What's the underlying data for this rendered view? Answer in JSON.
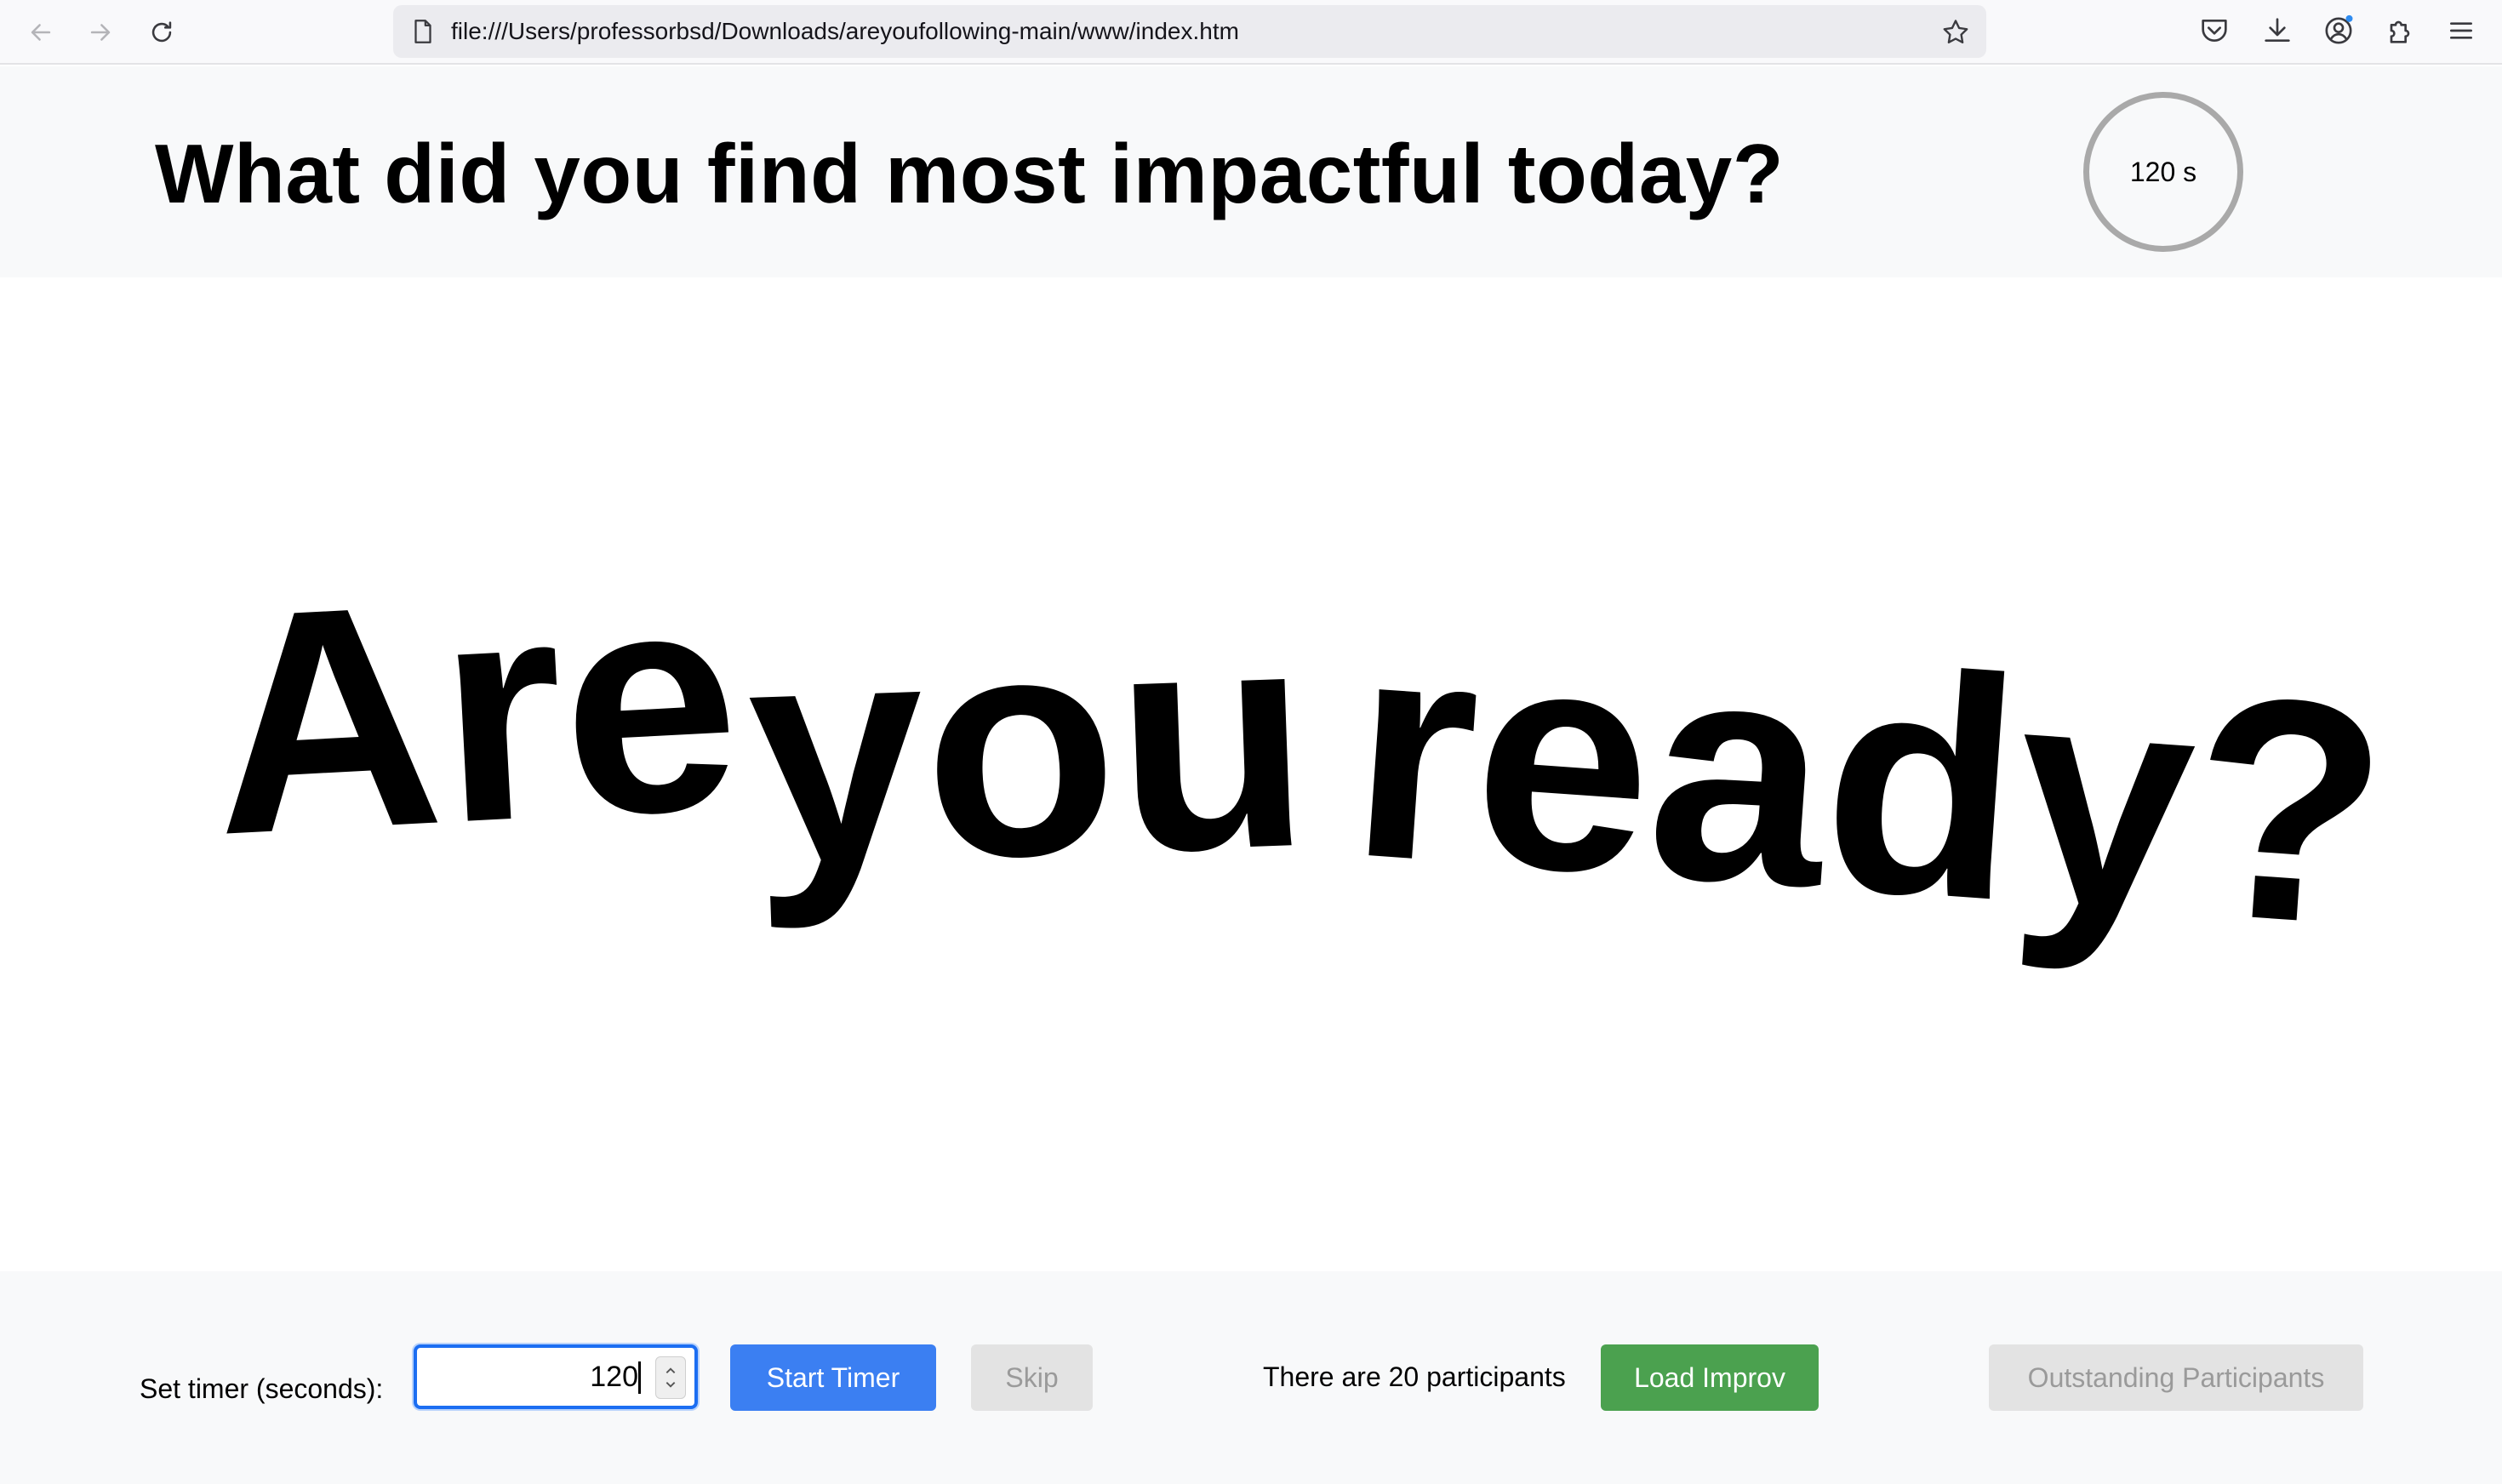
{
  "browser": {
    "url": "file:///Users/professorbsd/Downloads/areyoufollowing-main/www/index.htm",
    "toolbar_icons": [
      "back-arrow-icon",
      "forward-arrow-icon",
      "reload-icon",
      "page-icon",
      "bookmark-star-icon",
      "pocket-icon",
      "download-icon",
      "account-icon",
      "extensions-icon",
      "menu-icon"
    ]
  },
  "header": {
    "question": "What did you find most impactful today?",
    "timer_display": "120 s"
  },
  "stage": {
    "words": [
      "Are",
      "you",
      "ready?"
    ]
  },
  "controls": {
    "timer_label": "Set timer (seconds):",
    "timer_value": "120",
    "start_label": "Start Timer",
    "skip_label": "Skip",
    "participants_text": "There are 20 participants",
    "improv_label": "Load Improv",
    "outstanding_label": "Outstanding Participants"
  },
  "colors": {
    "start_button": "#3b7ff2",
    "improv_button": "#4ba14f",
    "disabled_button": "#e3e3e3",
    "timer_ring": "#a9a9a9"
  }
}
